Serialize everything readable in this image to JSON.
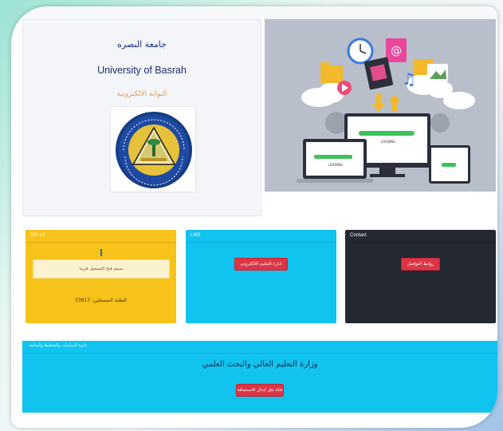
{
  "header": {
    "university_ar": "جامعة البصره",
    "university_en": "University of Basrah",
    "portal_ar": "البوابة الالكترونية"
  },
  "cards": {
    "sis": {
      "title": "SIS v.2",
      "notice": "سيتم فتح التسجيل قريبا",
      "registered": "الطلبة المسجلين: 33917"
    },
    "lms": {
      "title": "LMS",
      "button_label": "ادارة التعليم الالكتروني"
    },
    "contact": {
      "title": "Contact",
      "button_label": "روابط التواصل"
    }
  },
  "bottom": {
    "heading": "دائرة الدراسات والتخطيط والمتابعة",
    "title": "وزارة التعليم العالي والبحث العلمي",
    "button_label": "قناة نقل ابدال الاستضافة"
  },
  "hero_illustration": {
    "screen_labels": [
      "LOADING",
      "LOADING"
    ]
  },
  "colors": {
    "yellow": "#f7c21a",
    "cyan": "#11c3ef",
    "dark": "#242931",
    "red": "#dc3545"
  },
  "icons": [
    "university-logo",
    "clock-icon",
    "email-icon",
    "film-icon",
    "music-icon",
    "folder-icon",
    "image-icon",
    "play-icon",
    "cloud-icon",
    "arrow-up-icon",
    "arrow-down-icon"
  ]
}
